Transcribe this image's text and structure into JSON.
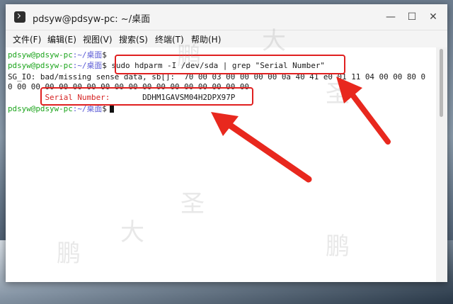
{
  "window": {
    "title": "pdsyw@pdsyw-pc: ~/桌面",
    "minimize_label": "—",
    "maximize_label": "☐",
    "close_label": "✕"
  },
  "menu": [
    "文件(F)",
    "编辑(E)",
    "视图(V)",
    "搜索(S)",
    "终端(T)",
    "帮助(H)"
  ],
  "terminal": {
    "prompt_user": "pdsyw@pdsyw-pc",
    "prompt_path": ":~/桌面",
    "prompt_sign": "$",
    "command": "sudo hdparm -I /dev/sda | grep \"Serial Number\"",
    "error_line_1": "SG_IO: bad/missing sense data, sb[]:  70 00 03 00 00 00 00 0a 40 41 e0 01 11 04 00 00 80 0",
    "error_line_2": "0 00 00 00 00 00 00 00 00 00 00 00 00 00 00 00 00 00",
    "serial_label": "Serial Number:",
    "serial_value": "DDHM1GAVSM04H2DPX97P"
  },
  "watermark": [
    "鹏",
    "大",
    "圣",
    "鹏",
    "大",
    "圣",
    "鹏"
  ],
  "colors": {
    "prompt_user": "#1ea51e",
    "prompt_path": "#5b5bd6",
    "highlight": "#e02020"
  }
}
